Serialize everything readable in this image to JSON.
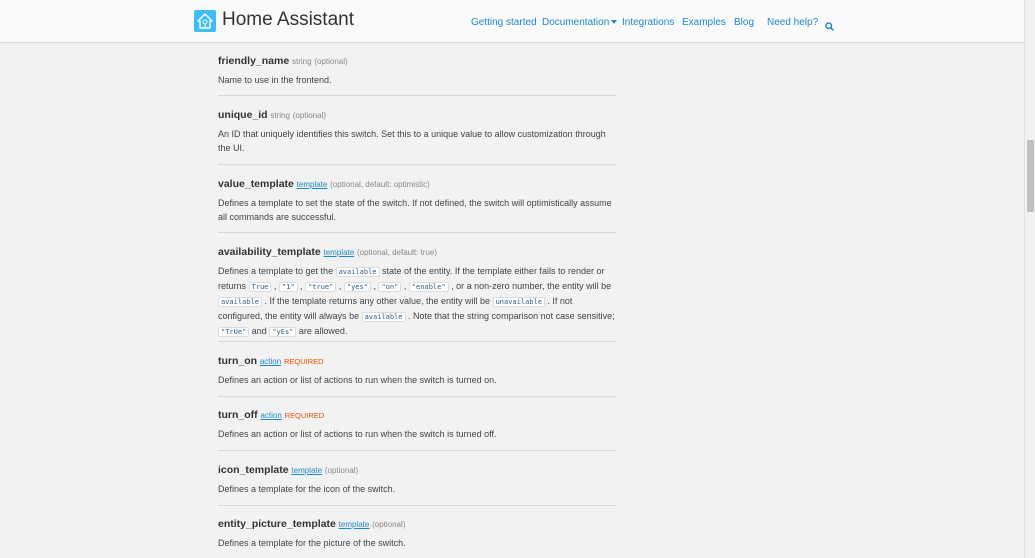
{
  "header": {
    "brand": "Home Assistant",
    "nav": [
      {
        "label": "Getting started"
      },
      {
        "label": "Documentation"
      },
      {
        "label": "Integrations"
      },
      {
        "label": "Examples"
      },
      {
        "label": "Blog"
      },
      {
        "label": "Need help?"
      }
    ]
  },
  "entries": [
    {
      "name": "friendly_name",
      "type": "string",
      "qualifier": "(optional)",
      "desc": "Name to use in the frontend."
    },
    {
      "name": "unique_id",
      "type": "string",
      "qualifier": "(optional)",
      "desc": "An ID that uniquely identifies this switch. Set this to a unique value to allow customization through the UI."
    },
    {
      "name": "value_template",
      "type": "template",
      "qualifier": "(optional, default: optimistic)",
      "desc": "Defines a template to set the state of the switch. If not defined, the switch will optimistically assume all commands are successful."
    },
    {
      "name": "availability_template",
      "type": "template",
      "qualifier": "(optional, default: true)",
      "desc_parts": {
        "t1": "Defines a template to get the ",
        "c1": "available",
        "t2": " state of the entity. If the template either fails to render or returns ",
        "c2": "True",
        "t3": " , ",
        "c3": "\"1\"",
        "t4": " , ",
        "c4": "\"true\"",
        "t5": " , ",
        "c5": "\"yes\"",
        "t6": " , ",
        "c6": "\"on\"",
        "t7": " , ",
        "c7": "\"enable\"",
        "t8": " , or a non-zero number, the entity will be ",
        "c8": "available",
        "t9": " . If the template returns any other value, the entity will be ",
        "c9": "unavailable",
        "t10": " . If not configured, the entity will always be ",
        "c10": "available",
        "t11": " . Note that the string comparison not case sensitive; ",
        "c11": "\"TrUe\"",
        "t12": " and ",
        "c12": "\"yEs\"",
        "t13": " are allowed."
      }
    },
    {
      "name": "turn_on",
      "type": "action",
      "qualifier": "REQUIRED",
      "desc": "Defines an action or list of actions to run when the switch is turned on."
    },
    {
      "name": "turn_off",
      "type": "action",
      "qualifier": "REQUIRED",
      "desc": "Defines an action or list of actions to run when the switch is turned off."
    },
    {
      "name": "icon_template",
      "type": "template",
      "qualifier": "(optional)",
      "desc": "Defines a template for the icon of the switch."
    },
    {
      "name": "entity_picture_template",
      "type": "template",
      "qualifier": "(optional)",
      "desc": "Defines a template for the picture of the switch."
    }
  ]
}
